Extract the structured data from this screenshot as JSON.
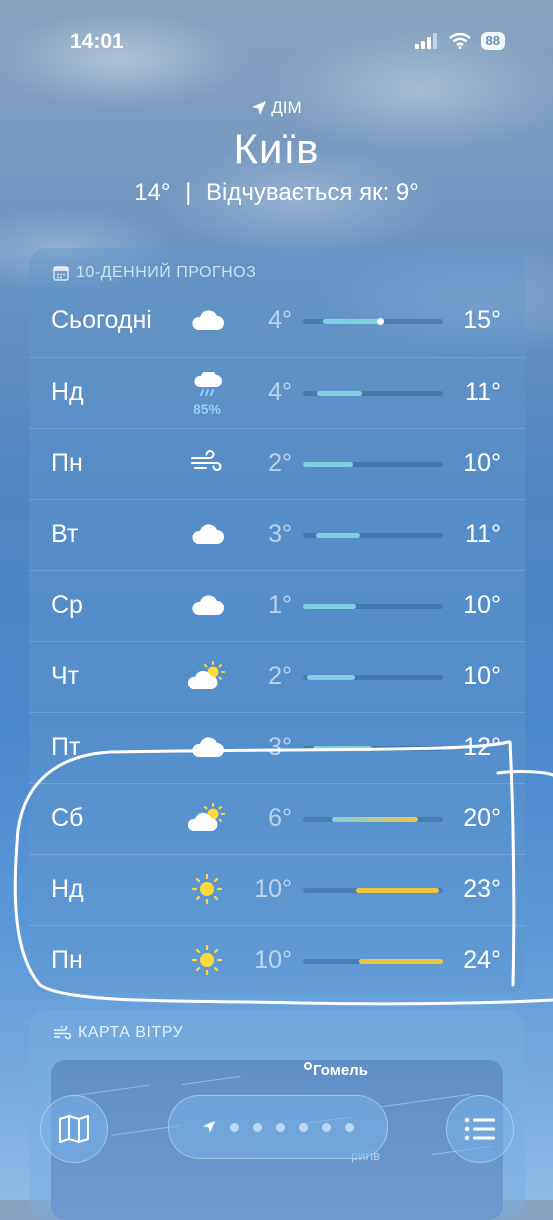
{
  "status_bar": {
    "time": "14:01",
    "battery": "88"
  },
  "header": {
    "location_label": "ДІМ",
    "city": "Київ",
    "current_temp": "14°",
    "separator": "|",
    "feels_like": "Відчувається як: 9°"
  },
  "forecast": {
    "title": "10-ДЕННИЙ ПРОГНОЗ",
    "icon": "calendar-icon",
    "days": [
      {
        "day": "Сьогодні",
        "icon": "cloud-icon",
        "precip": "",
        "low": "4°",
        "high": "15°",
        "range": [
          0.14,
          0.57
        ],
        "current": 0.55
      },
      {
        "day": "Нд",
        "icon": "rain-cloud-icon",
        "precip": "85%",
        "low": "4°",
        "high": "11°",
        "range": [
          0.1,
          0.42
        ]
      },
      {
        "day": "Пн",
        "icon": "wind-icon",
        "precip": "",
        "low": "2°",
        "high": "10°",
        "range": [
          0.0,
          0.36
        ]
      },
      {
        "day": "Вт",
        "icon": "cloud-icon",
        "precip": "",
        "low": "3°",
        "high": "11°",
        "range": [
          0.09,
          0.41
        ]
      },
      {
        "day": "Ср",
        "icon": "cloud-icon",
        "precip": "",
        "low": "1°",
        "high": "10°",
        "range": [
          0.0,
          0.38
        ]
      },
      {
        "day": "Чт",
        "icon": "partly-sunny-icon",
        "precip": "",
        "low": "2°",
        "high": "10°",
        "range": [
          0.03,
          0.37
        ]
      },
      {
        "day": "Пт",
        "icon": "cloud-icon",
        "precip": "",
        "low": "3°",
        "high": "12°",
        "range": [
          0.07,
          0.49
        ]
      },
      {
        "day": "Сб",
        "icon": "partly-sunny-icon",
        "precip": "",
        "low": "6°",
        "high": "20°",
        "range": [
          0.21,
          0.82
        ]
      },
      {
        "day": "Нд",
        "icon": "sun-icon",
        "precip": "",
        "low": "10°",
        "high": "23°",
        "range": [
          0.38,
          0.97
        ]
      },
      {
        "day": "Пн",
        "icon": "sun-icon",
        "precip": "",
        "low": "10°",
        "high": "24°",
        "range": [
          0.4,
          1.0
        ]
      }
    ]
  },
  "wind_map": {
    "title": "КАРТА ВІТРУ",
    "icon": "wind-icon",
    "city_label": "Гомель",
    "partial_label": "ригів"
  },
  "toolbar": {
    "map_icon": "map-icon",
    "list_icon": "list-icon",
    "location_icon": "location-arrow-icon",
    "page_count": 6
  },
  "colors": {
    "cool_bar": "#7fd0e0",
    "warm_bar": "#f1c43f",
    "sun": "#ffd83a"
  }
}
